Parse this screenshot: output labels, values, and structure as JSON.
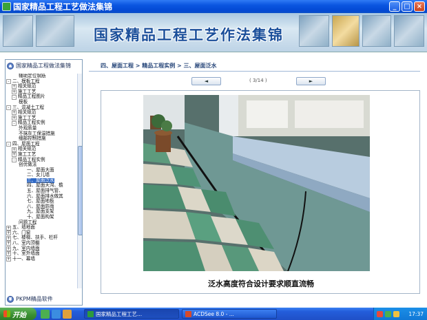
{
  "window": {
    "title": "国家精品工程工艺做法集锦",
    "buttons": {
      "minimize": "_",
      "maximize": "□",
      "close": "×"
    }
  },
  "banner": {
    "title": "国家精品工程工艺作法集锦"
  },
  "sidebar": {
    "header": "国家精品工程做法集锦",
    "footer": "PKPM精品软件",
    "tree": [
      {
        "label": "辅助定位钢筋",
        "level": 3,
        "toggle": ""
      },
      {
        "label": "二、模板工程",
        "level": 1,
        "toggle": "-"
      },
      {
        "label": "相关规范",
        "level": 2,
        "toggle": "+"
      },
      {
        "label": "施工工艺",
        "level": 2,
        "toggle": "+"
      },
      {
        "label": "精品工程图片",
        "level": 2,
        "toggle": "-"
      },
      {
        "label": "模板",
        "level": 3,
        "toggle": ""
      },
      {
        "label": "三、混凝土工程",
        "level": 1,
        "toggle": "-"
      },
      {
        "label": "相关规范",
        "level": 2,
        "toggle": "+"
      },
      {
        "label": "施工工艺",
        "level": 2,
        "toggle": "+"
      },
      {
        "label": "精品工程实例",
        "level": 2,
        "toggle": "-"
      },
      {
        "label": "外观质量",
        "level": 3,
        "toggle": ""
      },
      {
        "label": "不抹灰工保温措施",
        "level": 3,
        "toggle": ""
      },
      {
        "label": "细部控制措施",
        "level": 3,
        "toggle": ""
      },
      {
        "label": "四、屋面工程",
        "level": 1,
        "toggle": "-"
      },
      {
        "label": "相关规范",
        "level": 2,
        "toggle": "+"
      },
      {
        "label": "施工工艺",
        "level": 2,
        "toggle": "+"
      },
      {
        "label": "精品工程实例",
        "level": 2,
        "toggle": "-"
      },
      {
        "label": "创优做法",
        "level": 3,
        "toggle": ""
      },
      {
        "label": "一、屋面大面",
        "level": 4,
        "toggle": ""
      },
      {
        "label": "二、女儿墙",
        "level": 4,
        "toggle": ""
      },
      {
        "label": "三、屋面泛水",
        "level": 4,
        "toggle": "",
        "selected": true
      },
      {
        "label": "四、屋面天沟、檐",
        "level": 4,
        "toggle": ""
      },
      {
        "label": "五、屋面排气管、",
        "level": 4,
        "toggle": ""
      },
      {
        "label": "六、屋面排水做其",
        "level": 4,
        "toggle": ""
      },
      {
        "label": "七、屋面地板",
        "level": 4,
        "toggle": ""
      },
      {
        "label": "八、屋面防雨",
        "level": 4,
        "toggle": ""
      },
      {
        "label": "九、屋面支架",
        "level": 4,
        "toggle": ""
      },
      {
        "label": "十、屋面构架",
        "level": 4,
        "toggle": ""
      },
      {
        "label": "问题工程",
        "level": 3,
        "toggle": ""
      },
      {
        "label": "五、墙地面",
        "level": 1,
        "toggle": "+"
      },
      {
        "label": "六、门窗",
        "level": 1,
        "toggle": "+"
      },
      {
        "label": "七、楼梯、扶手、栏杆",
        "level": 1,
        "toggle": "+"
      },
      {
        "label": "八、室内顶棚",
        "level": 1,
        "toggle": "+"
      },
      {
        "label": "九、室内墙面",
        "level": 1,
        "toggle": "+"
      },
      {
        "label": "十、室外墙面",
        "level": 1,
        "toggle": "+"
      },
      {
        "label": "十一、幕墙",
        "level": 1,
        "toggle": "+"
      }
    ]
  },
  "main": {
    "breadcrumb": "四、屋面工程 > 精品工程实例 > 三、屋面泛水",
    "prev_label": "◄",
    "next_label": "►",
    "page_indicator": "( 3/14 )",
    "caption": "泛水高度符合设计要求顺直流畅"
  },
  "taskbar": {
    "start_label": "开始",
    "tasks": [
      {
        "label": "国家精品工程工艺...",
        "active": true
      },
      {
        "label": "ACDSee 8.0 - ...",
        "active": false
      }
    ],
    "clock": "17:37"
  }
}
